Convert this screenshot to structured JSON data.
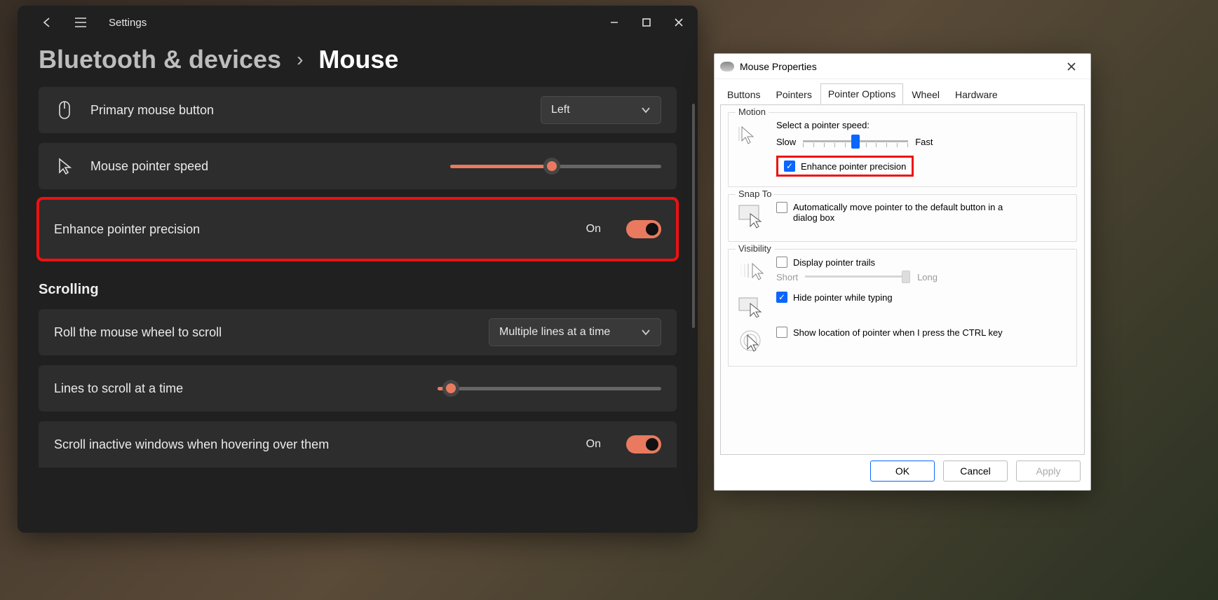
{
  "settings": {
    "app_title": "Settings",
    "breadcrumb_parent": "Bluetooth & devices",
    "breadcrumb_leaf": "Mouse",
    "primary_button": {
      "label": "Primary mouse button",
      "value": "Left"
    },
    "pointer_speed": {
      "label": "Mouse pointer speed",
      "value_pct": 48
    },
    "enhance_precision": {
      "label": "Enhance pointer precision",
      "state": "On"
    },
    "scrolling_heading": "Scrolling",
    "roll_wheel": {
      "label": "Roll the mouse wheel to scroll",
      "value": "Multiple lines at a time"
    },
    "lines_scroll": {
      "label": "Lines to scroll at a time",
      "value_pct": 6
    },
    "scroll_inactive": {
      "label": "Scroll inactive windows when hovering over them",
      "state": "On"
    }
  },
  "mp": {
    "title": "Mouse Properties",
    "tabs": {
      "buttons": "Buttons",
      "pointers": "Pointers",
      "pointer_options": "Pointer Options",
      "wheel": "Wheel",
      "hardware": "Hardware"
    },
    "motion": {
      "group": "Motion",
      "label": "Select a pointer speed:",
      "slow": "Slow",
      "fast": "Fast",
      "value_pct": 50,
      "enhance": "Enhance pointer precision",
      "enhance_checked": true
    },
    "snap": {
      "group": "Snap To",
      "label": "Automatically move pointer to the default button in a dialog box",
      "checked": false
    },
    "visibility": {
      "group": "Visibility",
      "trails": "Display pointer trails",
      "trails_checked": false,
      "short": "Short",
      "long": "Long",
      "hide_typing": "Hide pointer while typing",
      "hide_typing_checked": true,
      "show_ctrl": "Show location of pointer when I press the CTRL key",
      "show_ctrl_checked": false
    },
    "buttons": {
      "ok": "OK",
      "cancel": "Cancel",
      "apply": "Apply"
    }
  }
}
